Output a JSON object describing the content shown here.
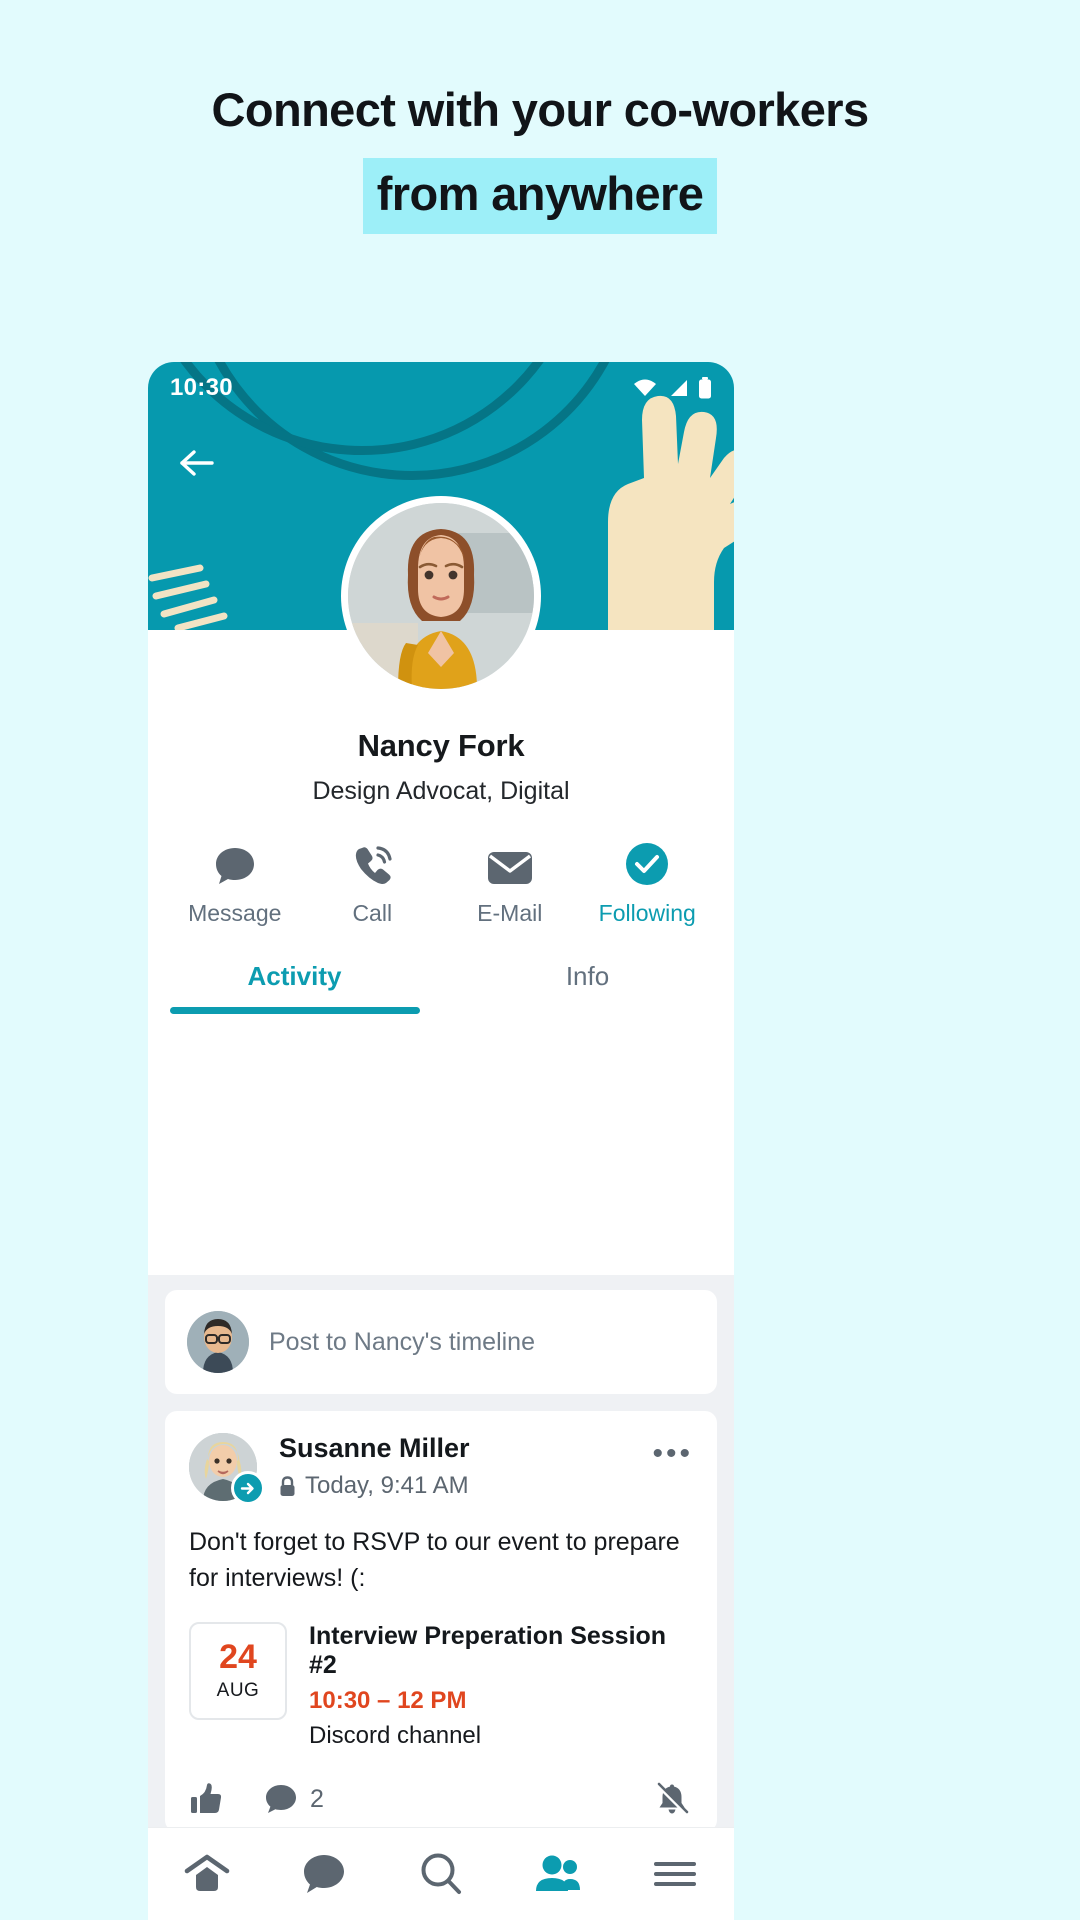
{
  "headline": {
    "line1": "Connect with your co-workers",
    "line2": "from anywhere",
    "highlight_color": "#9deff8"
  },
  "colors": {
    "page_background": "#e2fbfd",
    "teal": "#0699ae",
    "teal_dark": "#057586",
    "accent_red": "#e0461f",
    "slate": "#5c6670"
  },
  "statusbar": {
    "time": "10:30",
    "icons": [
      "wifi-icon",
      "cellular-icon",
      "battery-icon"
    ]
  },
  "header": {
    "back_icon": "back-arrow-icon"
  },
  "profile": {
    "name": "Nancy Fork",
    "role": "Design Advocat, Digital",
    "avatar": "profile-photo",
    "actions": [
      {
        "label": "Message",
        "icon": "chat-bubble-icon",
        "active": false
      },
      {
        "label": "Call",
        "icon": "phone-icon",
        "active": false
      },
      {
        "label": "E-Mail",
        "icon": "envelope-icon",
        "active": false
      },
      {
        "label": "Following",
        "icon": "check-circle-icon",
        "active": true
      }
    ]
  },
  "tabs": [
    {
      "label": "Activity",
      "active": true
    },
    {
      "label": "Info",
      "active": false
    }
  ],
  "composer": {
    "placeholder": "Post to Nancy's timeline",
    "avatar": "composer-avatar"
  },
  "post": {
    "author": "Susanne Miller",
    "lock_icon": "lock-icon",
    "timestamp": "Today, 9:41 AM",
    "menu_icon": "more-options-icon",
    "badge_icon": "share-arrow-icon",
    "body": "Don't forget to RSVP to our event to prepare for interviews! (:",
    "event": {
      "day": "24",
      "month": "AUG",
      "title": "Interview Preperation Session #2",
      "time": "10:30 – 12 PM",
      "location": "Discord channel"
    },
    "actions": {
      "like_icon": "thumbs-up-icon",
      "comment_icon": "comment-bubble-icon",
      "comment_count": "2",
      "notify_icon": "bell-slash-icon"
    }
  },
  "bottomnav": [
    {
      "icon": "home-icon",
      "active": false
    },
    {
      "icon": "chat-icon",
      "active": false
    },
    {
      "icon": "search-icon",
      "active": false
    },
    {
      "icon": "people-icon",
      "active": true
    },
    {
      "icon": "menu-icon",
      "active": false
    }
  ]
}
